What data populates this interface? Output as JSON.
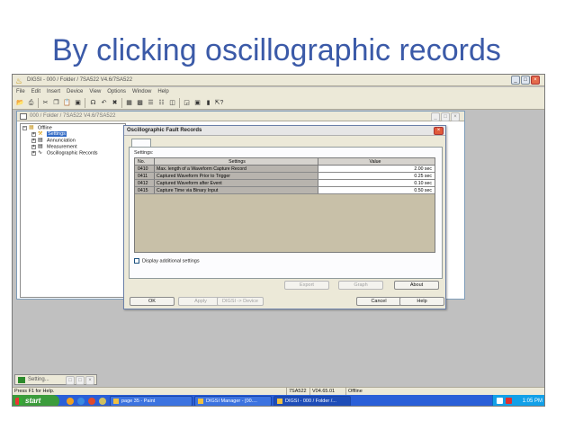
{
  "slide": {
    "title": "By clicking oscillographic records"
  },
  "app": {
    "title": "DIGSI - 000 / Folder / 7SA522 V4.6/7SA522",
    "menu": [
      "File",
      "Edit",
      "Insert",
      "Device",
      "View",
      "Options",
      "Window",
      "Help"
    ]
  },
  "child_window": {
    "title": "000 / Folder / 7SA522 V4.6/7SA522",
    "tree": [
      {
        "label": "Offline",
        "icon": "folder-icon"
      },
      {
        "label": "Settings",
        "icon": "settings-icon"
      },
      {
        "label": "Annunciation",
        "icon": "list-icon"
      },
      {
        "label": "Measurement",
        "icon": "meter-icon"
      },
      {
        "label": "Oscillographic Records",
        "icon": "wave-icon"
      }
    ]
  },
  "dialog": {
    "title": "Oscillographic Fault Records",
    "settings_label": "Settings:",
    "columns": [
      "No.",
      "Settings",
      "Value"
    ],
    "rows": [
      {
        "no": "0410",
        "setting": "Max. length of a Waveform Capture Record",
        "value": "2.00 sec"
      },
      {
        "no": "0411",
        "setting": "Captured Waveform Prior to Trigger",
        "value": "0.25 sec"
      },
      {
        "no": "0412",
        "setting": "Captured Waveform after Event",
        "value": "0.10 sec"
      },
      {
        "no": "0415",
        "setting": "Capture Time via Binary Input",
        "value": "0.50 sec"
      }
    ],
    "display_additional": "Display additional settings",
    "buttons": {
      "export": "Export",
      "graph": "Graph",
      "about": "About",
      "ok": "OK",
      "apply": "Apply",
      "digsi_device": "DIGSI -> Device",
      "cancel": "Cancel",
      "help": "Help"
    }
  },
  "minimized_window": {
    "title": "Setting..."
  },
  "statusbar": {
    "help": "Press F1 for Help.",
    "device": "7SA522",
    "version": "V04.65.01",
    "mode": "Offline"
  },
  "taskbar": {
    "start": "start",
    "tasks": [
      "page 35 - Paint",
      "DIGSI Manager - [00....",
      "DIGSI - 000 / Folder /..."
    ],
    "clock": "1:05 PM"
  },
  "colors": {
    "title_blue": "#3b5aa8",
    "taskbar_blue": "#2a5fd8",
    "start_green": "#3c9c3c",
    "grid_gray": "#c8c0a8"
  }
}
